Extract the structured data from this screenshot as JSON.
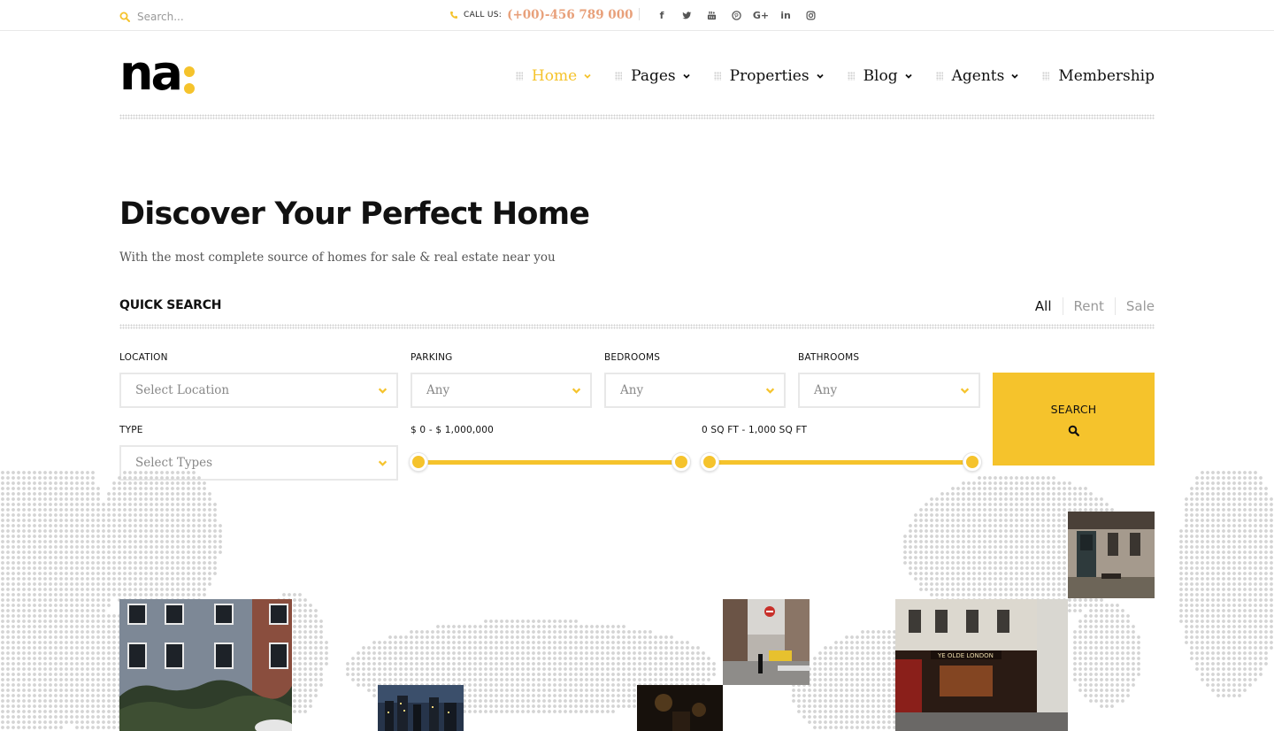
{
  "topbar": {
    "search_placeholder": "Search...",
    "call_label": "CALL US:",
    "phone": "(+00)-456 789 000",
    "social": [
      {
        "icon": "facebook-icon",
        "glyph": "f"
      },
      {
        "icon": "twitter-icon",
        "glyph": ""
      },
      {
        "icon": "youtube-icon",
        "glyph": ""
      },
      {
        "icon": "pinterest-icon",
        "glyph": ""
      },
      {
        "icon": "google-plus-icon",
        "glyph": "G+"
      },
      {
        "icon": "linkedin-icon",
        "glyph": "in"
      },
      {
        "icon": "instagram-icon",
        "glyph": ""
      }
    ]
  },
  "header": {
    "logo_text": "na",
    "nav": [
      {
        "label": "Home",
        "active": true,
        "dropdown": true
      },
      {
        "label": "Pages",
        "active": false,
        "dropdown": true
      },
      {
        "label": "Properties",
        "active": false,
        "dropdown": true
      },
      {
        "label": "Blog",
        "active": false,
        "dropdown": true
      },
      {
        "label": "Agents",
        "active": false,
        "dropdown": true
      },
      {
        "label": "Membership",
        "active": false,
        "dropdown": false
      }
    ]
  },
  "hero": {
    "title": "Discover Your Perfect Home",
    "subtitle": "With the most complete source of homes for sale & real estate near you"
  },
  "quick_search": {
    "title": "QUICK SEARCH",
    "tabs": [
      {
        "label": "All",
        "active": true
      },
      {
        "label": "Rent",
        "active": false
      },
      {
        "label": "Sale",
        "active": false
      }
    ],
    "location": {
      "label": "LOCATION",
      "value": "Select Location"
    },
    "parking": {
      "label": "PARKING",
      "value": "Any"
    },
    "bedrooms": {
      "label": "BEDROOMS",
      "value": "Any"
    },
    "bathrooms": {
      "label": "BATHROOMS",
      "value": "Any"
    },
    "type": {
      "label": "TYPE",
      "value": "Select Types"
    },
    "price_range": {
      "label": "$ 0 - $ 1,000,000",
      "min": 0,
      "max": 1000000,
      "low": 0,
      "high": 1000000
    },
    "area_range": {
      "label": "0 SQ FT - 1,000 SQ FT",
      "min": 0,
      "max": 1000,
      "low": 0,
      "high": 1000
    },
    "search_button": "SEARCH"
  },
  "colors": {
    "accent": "#f5c32c",
    "phone": "#e8a07a",
    "map_dots": "#d4d4d4"
  }
}
